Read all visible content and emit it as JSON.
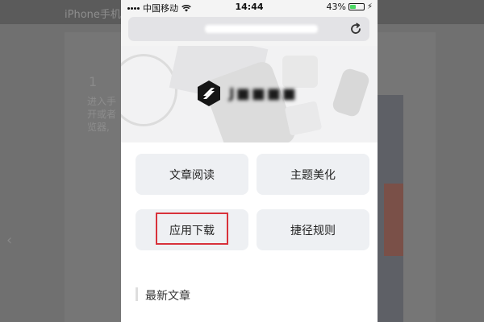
{
  "background": {
    "title": "iPhone手机",
    "number": "1",
    "text_lines": [
      "进入手",
      "开或者",
      "览器,"
    ]
  },
  "status_bar": {
    "carrier": "中国移动",
    "time": "14:44",
    "battery_percent": "43%",
    "battery_level": 0.43
  },
  "browser": {
    "reload_icon": "reload-icon"
  },
  "hero": {
    "logo_icon": "app-logo-icon"
  },
  "menu": {
    "read": "文章阅读",
    "theme": "主题美化",
    "download": "应用下载",
    "shortcut": "捷径规则"
  },
  "section": {
    "latest_title": "最新文章"
  },
  "colors": {
    "highlight": "#d8313a",
    "button_bg": "#eef0f3",
    "battery_green": "#4cd964"
  }
}
